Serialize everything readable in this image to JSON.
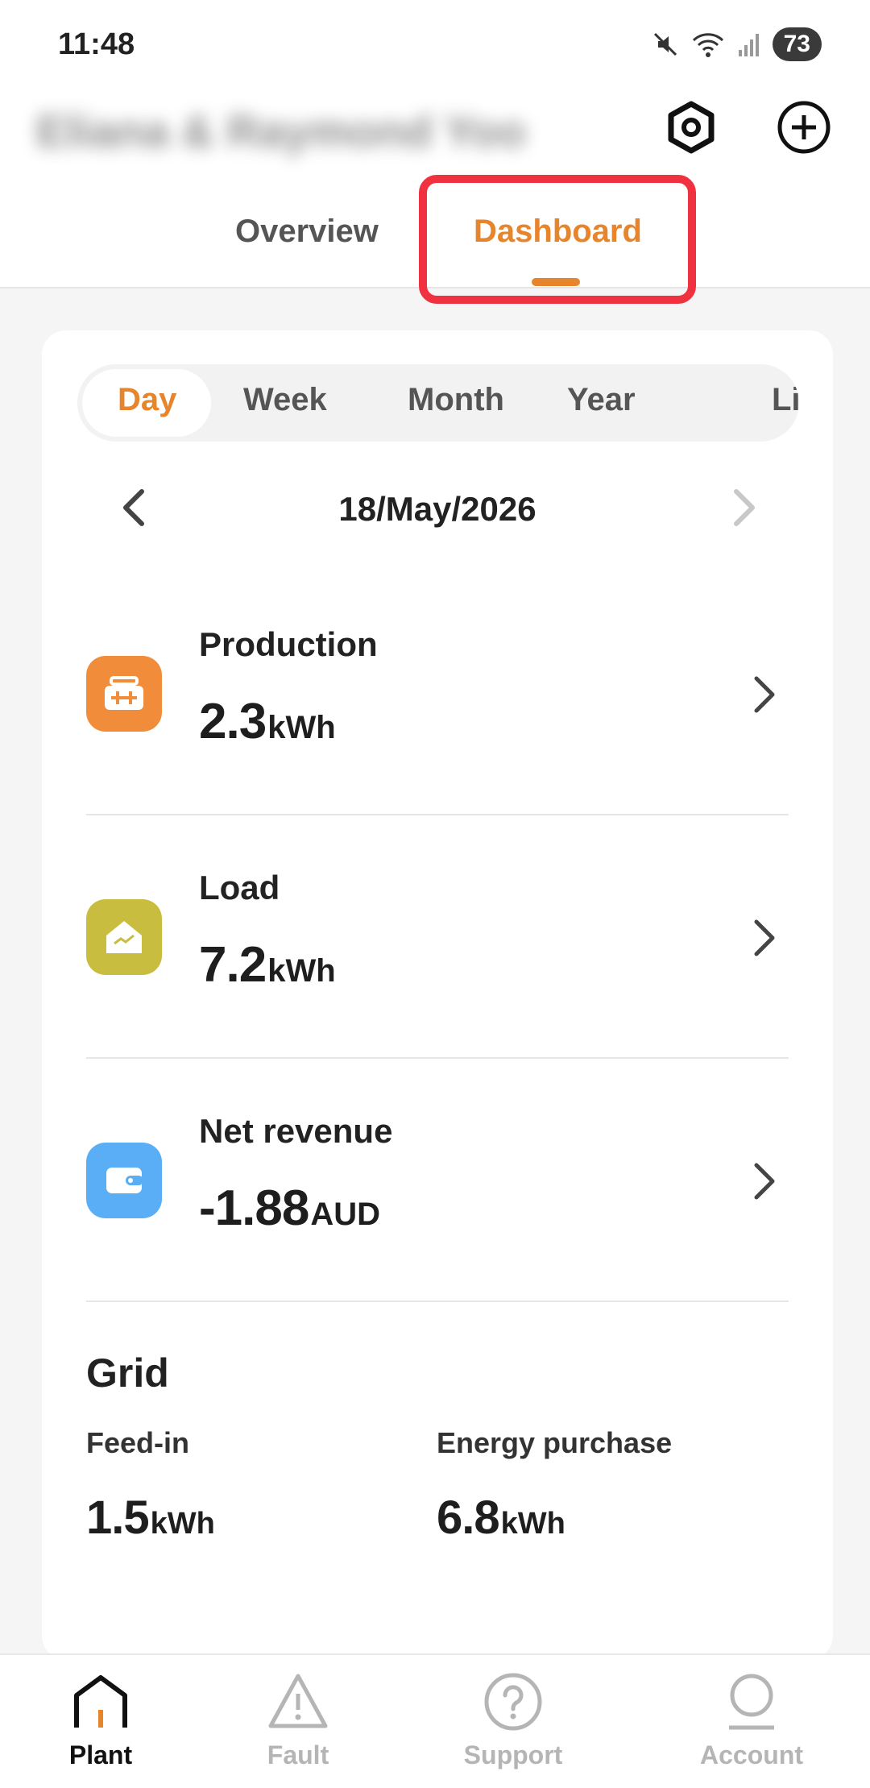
{
  "status_bar": {
    "time": "11:48",
    "battery": "73"
  },
  "header": {
    "plant_name": "Eliana & Raymond Yoo"
  },
  "tabs": [
    {
      "label": "Overview",
      "active": false
    },
    {
      "label": "Dashboard",
      "active": true
    }
  ],
  "period_tabs": [
    {
      "label": "Day",
      "active": true
    },
    {
      "label": "Week",
      "active": false
    },
    {
      "label": "Month",
      "active": false
    },
    {
      "label": "Year",
      "active": false
    },
    {
      "label": "Life",
      "active": false
    }
  ],
  "date": "18/May/2026",
  "metrics": [
    {
      "label": "Production",
      "value": "2.3",
      "unit": "kWh",
      "icon": "solar-panel-icon",
      "color": "#f08c3a"
    },
    {
      "label": "Load",
      "value": "7.2",
      "unit": "kWh",
      "icon": "home-load-icon",
      "color": "#c9bd3f"
    },
    {
      "label": "Net revenue",
      "value": "-1.88",
      "unit": "AUD",
      "icon": "wallet-icon",
      "color": "#5aaef5"
    }
  ],
  "grid": {
    "title": "Grid",
    "feed_in": {
      "label": "Feed-in",
      "value": "1.5",
      "unit": "kWh"
    },
    "energy_purchase": {
      "label": "Energy purchase",
      "value": "6.8",
      "unit": "kWh"
    }
  },
  "bottom_nav": [
    {
      "label": "Plant",
      "icon": "plant-house-icon",
      "active": true
    },
    {
      "label": "Fault",
      "icon": "warning-icon",
      "active": false
    },
    {
      "label": "Support",
      "icon": "question-icon",
      "active": false
    },
    {
      "label": "Account",
      "icon": "account-icon",
      "active": false
    }
  ],
  "colors": {
    "accent": "#e6852c",
    "highlight": "#f0313f"
  }
}
